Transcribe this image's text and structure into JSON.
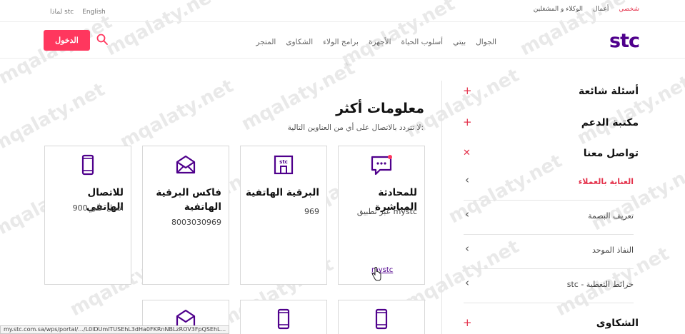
{
  "topbar": {
    "segments": [
      "شخصي",
      "أعمال",
      "الوكلاء و المشغلين"
    ],
    "active": "شخصي",
    "language": "English",
    "why_stc": "لماذا stc"
  },
  "header": {
    "logo": "stc",
    "menu": [
      "الجوال",
      "بيتي",
      "أسلوب الحياة",
      "الأجهزة",
      "برامج الولاء",
      "الشكاوى",
      "المتجر"
    ],
    "login_label": "الدخول"
  },
  "sidebar": {
    "sections": [
      {
        "title": "أسئلة شائعة",
        "icon": "plus-icon",
        "symbol": "+"
      },
      {
        "title": "مكتبة الدعم",
        "icon": "plus-icon",
        "symbol": "+"
      },
      {
        "title": "تواصل معنا",
        "icon": "close-icon",
        "symbol": "✕"
      }
    ],
    "contact_items": [
      {
        "label": "العناية بالعملاء",
        "active": true
      },
      {
        "label": "تعريف البصمة",
        "active": false
      },
      {
        "label": "النفاذ الموحد",
        "active": false
      },
      {
        "label": "stc - خرائط التغطية",
        "active": false
      }
    ],
    "complaints": {
      "title": "الشكاوى",
      "symbol": "+"
    },
    "chevron": "‹"
  },
  "main": {
    "title": "معلومات أكثر",
    "subtitle": "لا تتردد بالاتصال على أي من العناوين التالية:",
    "cards": [
      {
        "title": "للمحادثة المباشرة",
        "value": "عبر تطبيق mystc",
        "link": "mystc",
        "icon": "chat-icon"
      },
      {
        "title": "البرقية الهاتفية",
        "value": "969",
        "icon": "stc-store-icon"
      },
      {
        "title": "فاكس البرقية الهاتفية",
        "value": "8003030969",
        "icon": "envelope-icon"
      },
      {
        "title": "للاتصال الهاتفي",
        "value": "اتصل على 900",
        "icon": "mobile-phone-icon"
      }
    ]
  },
  "status_bar": {
    "url": "my.stc.com.sa/wps/portal/.../L0lDUmlTUSEhL3dHa0FKRnNBLzROV3FpQSEhL..."
  },
  "watermark": "mqalaty.net",
  "colors": {
    "brand_purple": "#4f008c",
    "accent_pink": "#ff375e",
    "accent_red": "#e4314b"
  }
}
